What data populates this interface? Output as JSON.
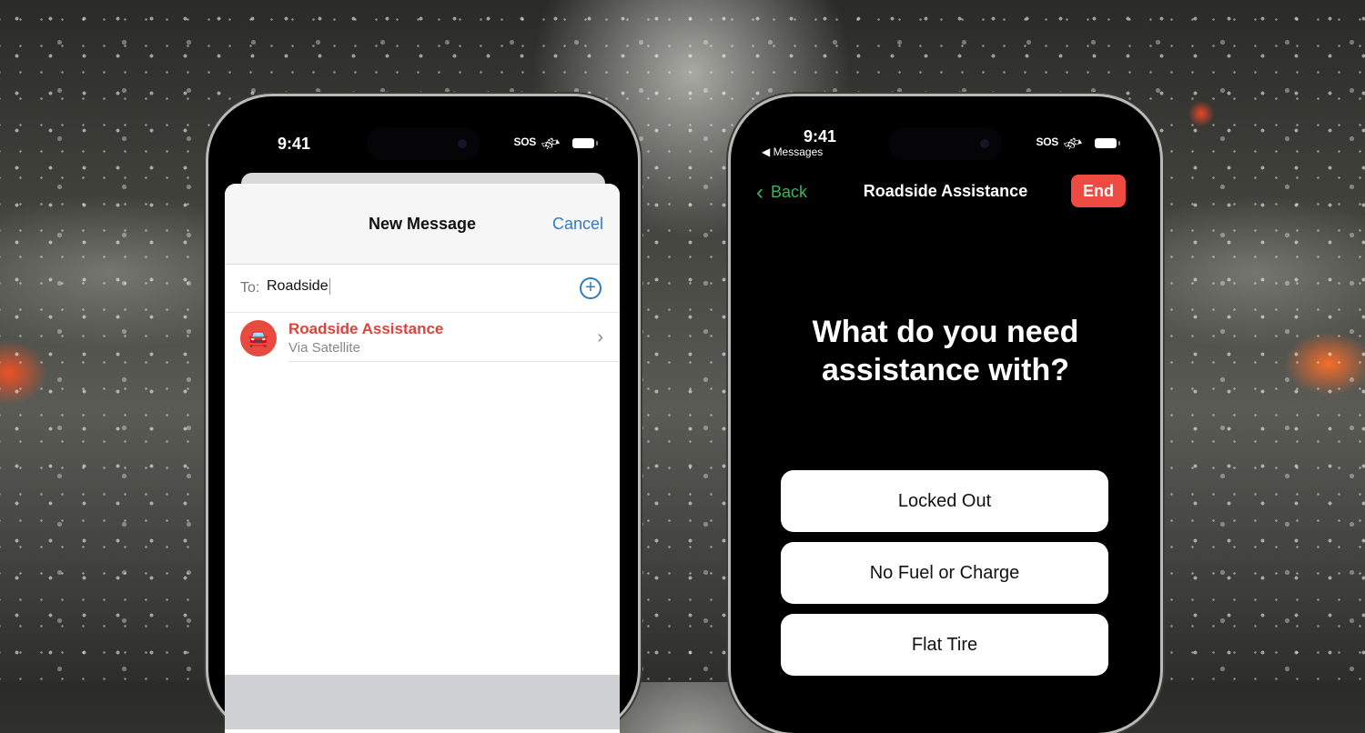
{
  "left_phone": {
    "status": {
      "time": "9:41",
      "sos": "SOS",
      "satellite_icon": "satellite-icon",
      "battery_icon": "battery-icon"
    },
    "sheet": {
      "title": "New Message",
      "cancel_label": "Cancel",
      "to_label": "To:",
      "to_value": "Roadside",
      "add_icon": "plus-circle-icon",
      "suggestion": {
        "name": "Roadside Assistance",
        "subtitle": "Via Satellite",
        "avatar_icon": "car-satellite-icon",
        "chevron_icon": "chevron-right-icon"
      }
    }
  },
  "right_phone": {
    "status": {
      "time": "9:41",
      "back_app": "◀ Messages",
      "sos": "SOS",
      "satellite_icon": "satellite-icon",
      "battery_icon": "battery-icon"
    },
    "nav": {
      "back_label": "Back",
      "title": "Roadside Assistance",
      "end_label": "End"
    },
    "question": "What do you need assistance with?",
    "options": [
      "Locked Out",
      "No Fuel or Charge",
      "Flat Tire"
    ]
  },
  "colors": {
    "accent_blue": "#2f7bc0",
    "accent_red": "#ef4a42",
    "accent_green": "#3bb55a"
  }
}
